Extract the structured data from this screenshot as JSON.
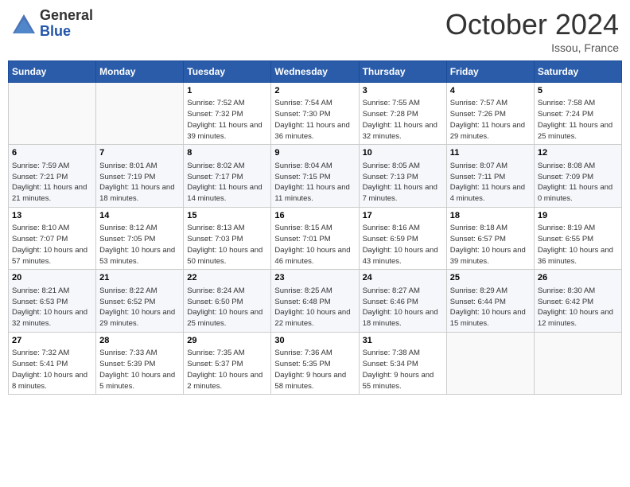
{
  "logo": {
    "general": "General",
    "blue": "Blue"
  },
  "title": "October 2024",
  "location": "Issou, France",
  "days_header": [
    "Sunday",
    "Monday",
    "Tuesday",
    "Wednesday",
    "Thursday",
    "Friday",
    "Saturday"
  ],
  "weeks": [
    [
      {
        "day": "",
        "info": ""
      },
      {
        "day": "",
        "info": ""
      },
      {
        "day": "1",
        "info": "Sunrise: 7:52 AM\nSunset: 7:32 PM\nDaylight: 11 hours and 39 minutes."
      },
      {
        "day": "2",
        "info": "Sunrise: 7:54 AM\nSunset: 7:30 PM\nDaylight: 11 hours and 36 minutes."
      },
      {
        "day": "3",
        "info": "Sunrise: 7:55 AM\nSunset: 7:28 PM\nDaylight: 11 hours and 32 minutes."
      },
      {
        "day": "4",
        "info": "Sunrise: 7:57 AM\nSunset: 7:26 PM\nDaylight: 11 hours and 29 minutes."
      },
      {
        "day": "5",
        "info": "Sunrise: 7:58 AM\nSunset: 7:24 PM\nDaylight: 11 hours and 25 minutes."
      }
    ],
    [
      {
        "day": "6",
        "info": "Sunrise: 7:59 AM\nSunset: 7:21 PM\nDaylight: 11 hours and 21 minutes."
      },
      {
        "day": "7",
        "info": "Sunrise: 8:01 AM\nSunset: 7:19 PM\nDaylight: 11 hours and 18 minutes."
      },
      {
        "day": "8",
        "info": "Sunrise: 8:02 AM\nSunset: 7:17 PM\nDaylight: 11 hours and 14 minutes."
      },
      {
        "day": "9",
        "info": "Sunrise: 8:04 AM\nSunset: 7:15 PM\nDaylight: 11 hours and 11 minutes."
      },
      {
        "day": "10",
        "info": "Sunrise: 8:05 AM\nSunset: 7:13 PM\nDaylight: 11 hours and 7 minutes."
      },
      {
        "day": "11",
        "info": "Sunrise: 8:07 AM\nSunset: 7:11 PM\nDaylight: 11 hours and 4 minutes."
      },
      {
        "day": "12",
        "info": "Sunrise: 8:08 AM\nSunset: 7:09 PM\nDaylight: 11 hours and 0 minutes."
      }
    ],
    [
      {
        "day": "13",
        "info": "Sunrise: 8:10 AM\nSunset: 7:07 PM\nDaylight: 10 hours and 57 minutes."
      },
      {
        "day": "14",
        "info": "Sunrise: 8:12 AM\nSunset: 7:05 PM\nDaylight: 10 hours and 53 minutes."
      },
      {
        "day": "15",
        "info": "Sunrise: 8:13 AM\nSunset: 7:03 PM\nDaylight: 10 hours and 50 minutes."
      },
      {
        "day": "16",
        "info": "Sunrise: 8:15 AM\nSunset: 7:01 PM\nDaylight: 10 hours and 46 minutes."
      },
      {
        "day": "17",
        "info": "Sunrise: 8:16 AM\nSunset: 6:59 PM\nDaylight: 10 hours and 43 minutes."
      },
      {
        "day": "18",
        "info": "Sunrise: 8:18 AM\nSunset: 6:57 PM\nDaylight: 10 hours and 39 minutes."
      },
      {
        "day": "19",
        "info": "Sunrise: 8:19 AM\nSunset: 6:55 PM\nDaylight: 10 hours and 36 minutes."
      }
    ],
    [
      {
        "day": "20",
        "info": "Sunrise: 8:21 AM\nSunset: 6:53 PM\nDaylight: 10 hours and 32 minutes."
      },
      {
        "day": "21",
        "info": "Sunrise: 8:22 AM\nSunset: 6:52 PM\nDaylight: 10 hours and 29 minutes."
      },
      {
        "day": "22",
        "info": "Sunrise: 8:24 AM\nSunset: 6:50 PM\nDaylight: 10 hours and 25 minutes."
      },
      {
        "day": "23",
        "info": "Sunrise: 8:25 AM\nSunset: 6:48 PM\nDaylight: 10 hours and 22 minutes."
      },
      {
        "day": "24",
        "info": "Sunrise: 8:27 AM\nSunset: 6:46 PM\nDaylight: 10 hours and 18 minutes."
      },
      {
        "day": "25",
        "info": "Sunrise: 8:29 AM\nSunset: 6:44 PM\nDaylight: 10 hours and 15 minutes."
      },
      {
        "day": "26",
        "info": "Sunrise: 8:30 AM\nSunset: 6:42 PM\nDaylight: 10 hours and 12 minutes."
      }
    ],
    [
      {
        "day": "27",
        "info": "Sunrise: 7:32 AM\nSunset: 5:41 PM\nDaylight: 10 hours and 8 minutes."
      },
      {
        "day": "28",
        "info": "Sunrise: 7:33 AM\nSunset: 5:39 PM\nDaylight: 10 hours and 5 minutes."
      },
      {
        "day": "29",
        "info": "Sunrise: 7:35 AM\nSunset: 5:37 PM\nDaylight: 10 hours and 2 minutes."
      },
      {
        "day": "30",
        "info": "Sunrise: 7:36 AM\nSunset: 5:35 PM\nDaylight: 9 hours and 58 minutes."
      },
      {
        "day": "31",
        "info": "Sunrise: 7:38 AM\nSunset: 5:34 PM\nDaylight: 9 hours and 55 minutes."
      },
      {
        "day": "",
        "info": ""
      },
      {
        "day": "",
        "info": ""
      }
    ]
  ]
}
